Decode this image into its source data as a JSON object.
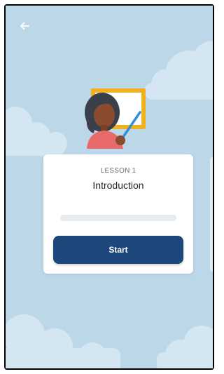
{
  "header": {
    "back_icon": "arrow-left-icon"
  },
  "illustration": {
    "icon": "teacher-at-whiteboard-illustration"
  },
  "lesson_card": {
    "lesson_label": "LESSON 1",
    "title": "Introduction",
    "progress_fraction": 0,
    "start_label": "Start"
  },
  "colors": {
    "background": "#bcd8e8",
    "accent": "#1d477b",
    "card": "#ffffff",
    "progress_track": "#e6ebf0"
  }
}
